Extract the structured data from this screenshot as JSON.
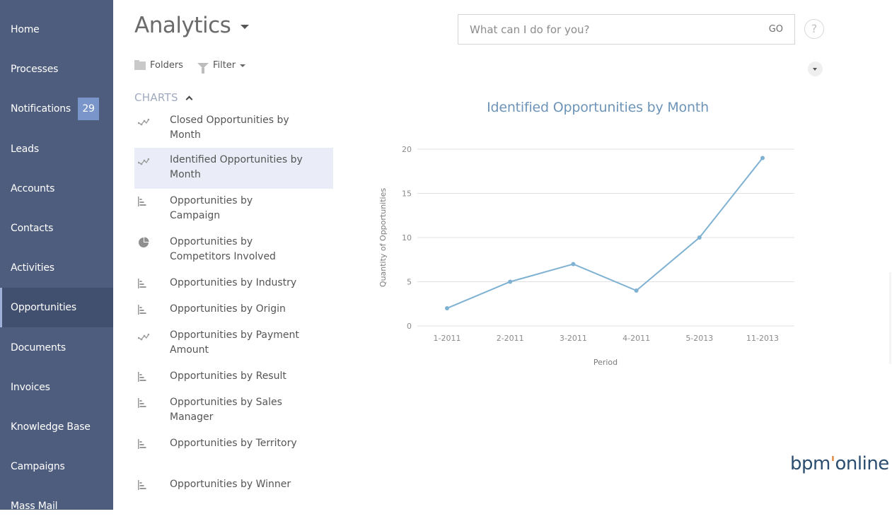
{
  "sidebar": {
    "items": [
      {
        "label": "Home"
      },
      {
        "label": "Processes"
      },
      {
        "label": "Notifications",
        "badge": "29"
      },
      {
        "label": "Leads"
      },
      {
        "label": "Accounts"
      },
      {
        "label": "Contacts"
      },
      {
        "label": "Activities"
      },
      {
        "label": "Opportunities",
        "active": true
      },
      {
        "label": "Documents"
      },
      {
        "label": "Invoices"
      },
      {
        "label": "Knowledge Base"
      },
      {
        "label": "Campaigns"
      },
      {
        "label": "Mass Mail"
      }
    ]
  },
  "header": {
    "title": "Analytics",
    "folders_label": "Folders",
    "filter_label": "Filter"
  },
  "search": {
    "placeholder": "What can I do for you?",
    "go_label": "GO",
    "help_label": "?"
  },
  "charts_section": {
    "title": "CHARTS",
    "items": [
      {
        "label": "Closed Opportunities by Month",
        "icon": "line-chart-icon"
      },
      {
        "label": "Identified Opportunities by Month",
        "icon": "line-chart-icon",
        "selected": true
      },
      {
        "label": "Opportunities by Campaign",
        "icon": "bar-chart-icon"
      },
      {
        "label": "Opportunities by Competitors Involved",
        "icon": "pie-chart-icon"
      },
      {
        "label": "Opportunities by Industry",
        "icon": "bar-chart-icon"
      },
      {
        "label": "Opportunities by Origin",
        "icon": "bar-chart-icon"
      },
      {
        "label": "Opportunities by Payment Amount",
        "icon": "line-chart-icon"
      },
      {
        "label": "Opportunities by Result",
        "icon": "bar-chart-icon"
      },
      {
        "label": "Opportunities by Sales Manager",
        "icon": "bar-chart-icon"
      },
      {
        "label": "Opportunities by Territory",
        "icon": "bar-chart-icon"
      },
      {
        "label": "Opportunities by Winner",
        "icon": "bar-chart-icon"
      }
    ]
  },
  "colors": {
    "sidebar_bg": "#4e5d7d",
    "badge_bg": "#7a95c9",
    "series_line": "#7fb1d2",
    "chart_title": "#6e94b8"
  },
  "chart_data": {
    "type": "line",
    "title": "Identified Opportunities by Month",
    "xlabel": "Period",
    "ylabel": "Quantity of Opportunities",
    "categories": [
      "1-2011",
      "2-2011",
      "3-2011",
      "4-2011",
      "5-2013",
      "11-2013"
    ],
    "series": [
      {
        "name": "Quantity of Opportunities",
        "values": [
          2,
          5,
          7,
          4,
          10,
          19
        ]
      }
    ],
    "yticks": [
      0,
      5,
      10,
      15,
      20
    ],
    "ylim": [
      0,
      20
    ],
    "grid": true,
    "legend": "none"
  },
  "logo": {
    "text_a": "bpm",
    "text_dot": "'",
    "text_b": "online"
  }
}
